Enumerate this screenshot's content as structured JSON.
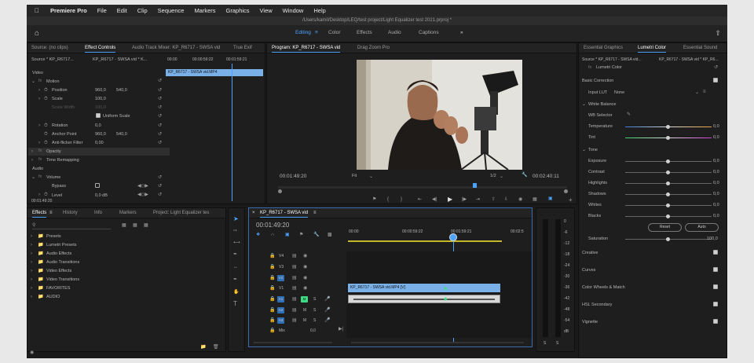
{
  "menu": {
    "apple": "",
    "app": "Premiere Pro",
    "items": [
      "File",
      "Edit",
      "Clip",
      "Sequence",
      "Markers",
      "Graphics",
      "View",
      "Window",
      "Help"
    ]
  },
  "title_path": "/Users/kamil/Desktop/LEQ/test project/Light Equalizer test 2021.prproj *",
  "workspace": {
    "tabs": [
      "Editing",
      "Color",
      "Effects",
      "Audio",
      "Captions"
    ],
    "active": "Editing",
    "more": "»"
  },
  "source_panel": {
    "tabs": [
      "Source: (no clips)",
      "Effect Controls",
      "Audio Track Mixer: KP_R6717 - SWSA vid",
      "True Exif"
    ],
    "active_tab": "Effect Controls",
    "source_label": "Source * KP_R6717...",
    "sequence_label": "KP_R6717 - SWSA vid * K...",
    "times": [
      "00:00",
      "00:00:59:22",
      "00:01:59:21"
    ],
    "clip_name": "KP_R6717 - SWSA vid.MP4",
    "video_header": "Video",
    "motion": {
      "name": "Motion",
      "position_label": "Position",
      "position_x": "960,0",
      "position_y": "540,0",
      "scale_label": "Scale",
      "scale": "100,0",
      "scale_width_label": "Scale Width",
      "scale_width": "100,0",
      "uniform_label": "Uniform Scale",
      "rotation_label": "Rotation",
      "rotation": "0,0",
      "anchor_label": "Anchor Point",
      "anchor_x": "960,0",
      "anchor_y": "540,0",
      "antiflicker_label": "Anti-flicker Filter",
      "antiflicker": "0,00"
    },
    "opacity": "Opacity",
    "time_remap": "Time Remapping",
    "audio_header": "Audio",
    "volume": {
      "name": "Volume",
      "bypass_label": "Bypass",
      "level_label": "Level",
      "level": "0,0 dB"
    },
    "timecode": "00:01:49:20"
  },
  "program": {
    "tabs": [
      "Program: KP_R6717 - SWSA vid",
      "Drag Zoom Pro"
    ],
    "timecode": "00:01:49:20",
    "fit": "Fit",
    "resolution": "1/2",
    "duration": "00:02:40:11"
  },
  "lumetri": {
    "tabs": [
      "Essential Graphics",
      "Lumetri Color",
      "Essential Sound"
    ],
    "source_label": "Source * KP_R6717 - SWSA vid...",
    "seq_label": "KP_R6717 - SWSA vid * KP_R6...",
    "effect_name": "Lumetri Color",
    "basic": "Basic Correction",
    "input_lut_label": "Input LUT",
    "input_lut": "None",
    "white_balance": "White Balance",
    "wb_selector": "WB Selector",
    "temperature": {
      "label": "Temperature",
      "value": "0,0"
    },
    "tint": {
      "label": "Tint",
      "value": "0,0"
    },
    "tone": "Tone",
    "exposure": {
      "label": "Exposure",
      "value": "0,0"
    },
    "contrast": {
      "label": "Contrast",
      "value": "0,0"
    },
    "highlights": {
      "label": "Highlights",
      "value": "0,0"
    },
    "shadows": {
      "label": "Shadows",
      "value": "0,0"
    },
    "whites": {
      "label": "Whites",
      "value": "0,0"
    },
    "blacks": {
      "label": "Blacks",
      "value": "0,0"
    },
    "reset": "Reset",
    "auto": "Auto",
    "saturation": {
      "label": "Saturation",
      "value": "100,0"
    },
    "sections": [
      "Creative",
      "Curves",
      "Color Wheels & Match",
      "HSL Secondary",
      "Vignette"
    ]
  },
  "project": {
    "tabs": [
      "Effects",
      "History",
      "Info",
      "Markers",
      "Project: Light Equalizer tes"
    ],
    "items": [
      "Presets",
      "Lumetri Presets",
      "Audio Effects",
      "Audio Transitions",
      "Video Effects",
      "Video Transitions",
      "FAVORITES",
      "AUDIO"
    ]
  },
  "timeline": {
    "tab": "KP_R6717 - SWSA vid",
    "timecode": "00:01:49:20",
    "ruler": [
      "00:00",
      "00:00:59:22",
      "00:01:59:21",
      "00:02:5"
    ],
    "tracks": [
      "V4",
      "V3",
      "V2",
      "V1",
      "A1",
      "A2",
      "A3"
    ],
    "mix_label": "Mix",
    "mix_value": "0,0",
    "video_clip": "KP_R6717 - SWSA vid.MP4 [V]"
  },
  "meter": {
    "ticks": [
      "0",
      "-6",
      "-12",
      "-18",
      "-24",
      "-30",
      "-36",
      "-42",
      "-48",
      "-54",
      "dB"
    ],
    "bottom": [
      "S",
      "S"
    ]
  },
  "colors": {
    "accent": "#4ca3ff",
    "clip": "#7ab0e8",
    "mute": "#3ddc84"
  }
}
